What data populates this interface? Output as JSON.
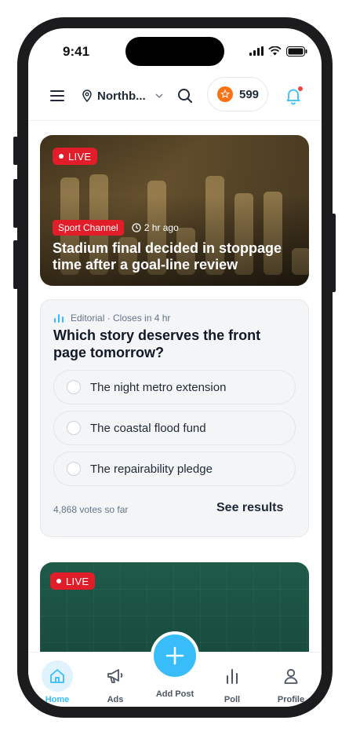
{
  "status_bar": {
    "time": "9:41"
  },
  "header": {
    "location": "Northb...",
    "points": "599"
  },
  "hero": {
    "live_label": "LIVE",
    "category": "Sport Channel",
    "time_ago": "2 hr ago",
    "title": "Stadium final decided in stoppage time after a goal-line review"
  },
  "poll": {
    "meta": "Editorial · Closes in 4 hr",
    "question": "Which story deserves the front page tomorrow?",
    "options": [
      {
        "label": "The night metro extension"
      },
      {
        "label": "The coastal flood fund"
      },
      {
        "label": "The repairability pledge"
      }
    ],
    "votes": "4,868 votes so far",
    "see_results": "See results"
  },
  "card2": {
    "live_label": "LIVE"
  },
  "tabs": [
    {
      "label": "Home",
      "icon": "home-icon"
    },
    {
      "label": "Ads",
      "icon": "megaphone-icon"
    },
    {
      "label": "Add Post",
      "icon": "plus-icon"
    },
    {
      "label": "Poll",
      "icon": "bar-chart-icon"
    },
    {
      "label": "Profile",
      "icon": "user-icon"
    }
  ],
  "colors": {
    "accent": "#38bdf8",
    "live": "#e11d2a",
    "notification_dot": "#ef4444",
    "coin": "#f97316"
  }
}
